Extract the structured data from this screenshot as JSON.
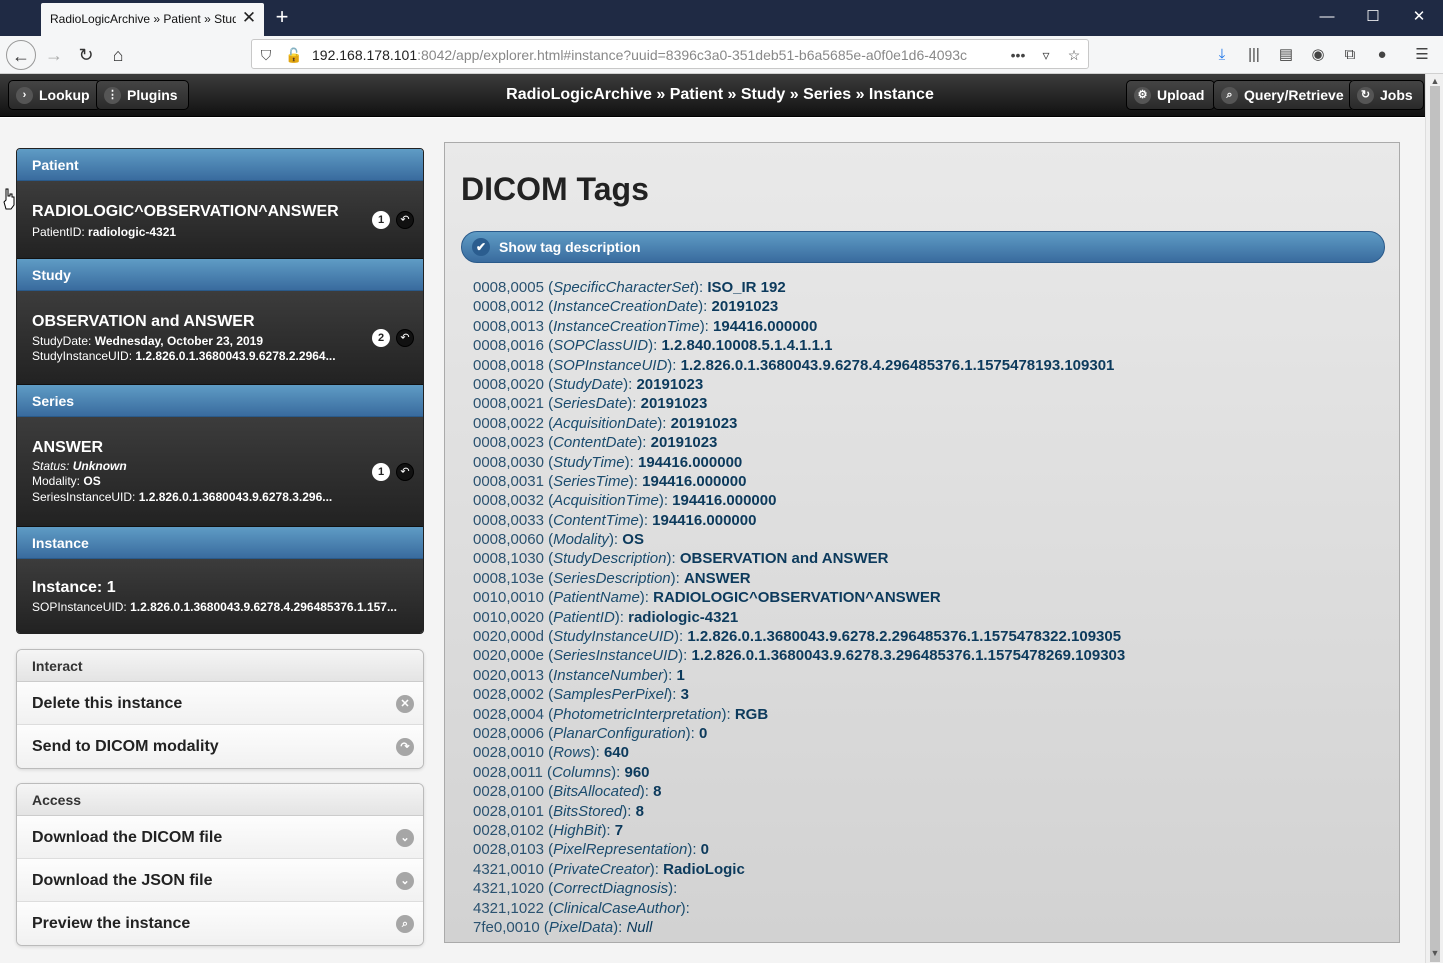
{
  "browser": {
    "tab_title": "RadioLogicArchive » Patient » Stud",
    "url_host": "192.168.178.101",
    "url_rest": ":8042/app/explorer.html#instance?uuid=8396c3a0-351deb51-b6a5685e-a0f0e1d6-4093c"
  },
  "header": {
    "lookup_label": "Lookup",
    "plugins_label": "Plugins",
    "title": "RadioLogicArchive » Patient » Study » Series » Instance",
    "upload_label": "Upload",
    "query_label": "Query/Retrieve",
    "jobs_label": "Jobs"
  },
  "nav": {
    "patient": {
      "divider": "Patient",
      "name": "RADIOLOGIC^OBSERVATION^ANSWER",
      "id_label": "PatientID:",
      "id_value": "radiologic-4321",
      "count": "1"
    },
    "study": {
      "divider": "Study",
      "title": "OBSERVATION and ANSWER",
      "date_label": "StudyDate:",
      "date_value": "Wednesday, October 23, 2019",
      "uid_label": "StudyInstanceUID:",
      "uid_value": "1.2.826.0.1.3680043.9.6278.2.2964...",
      "count": "2"
    },
    "series": {
      "divider": "Series",
      "title": "ANSWER",
      "status_label": "Status:",
      "status_value": "Unknown",
      "modality_label": "Modality:",
      "modality_value": "OS",
      "uid_label": "SeriesInstanceUID:",
      "uid_value": "1.2.826.0.1.3680043.9.6278.3.296...",
      "count": "1"
    },
    "instance": {
      "divider": "Instance",
      "title": "Instance: 1",
      "uid_label": "SOPInstanceUID:",
      "uid_value": "1.2.826.0.1.3680043.9.6278.4.296485376.1.157..."
    }
  },
  "interact": {
    "heading": "Interact",
    "delete_label": "Delete this instance",
    "send_label": "Send to DICOM modality"
  },
  "access": {
    "heading": "Access",
    "download_dicom": "Download the DICOM file",
    "download_json": "Download the JSON file",
    "preview": "Preview the instance"
  },
  "main": {
    "heading": "DICOM Tags",
    "toggle_label": "Show tag description",
    "tags": [
      {
        "id": "0008,0005",
        "name": "SpecificCharacterSet",
        "value": "ISO_IR 192"
      },
      {
        "id": "0008,0012",
        "name": "InstanceCreationDate",
        "value": "20191023"
      },
      {
        "id": "0008,0013",
        "name": "InstanceCreationTime",
        "value": "194416.000000"
      },
      {
        "id": "0008,0016",
        "name": "SOPClassUID",
        "value": "1.2.840.10008.5.1.4.1.1.1"
      },
      {
        "id": "0008,0018",
        "name": "SOPInstanceUID",
        "value": "1.2.826.0.1.3680043.9.6278.4.296485376.1.1575478193.109301"
      },
      {
        "id": "0008,0020",
        "name": "StudyDate",
        "value": "20191023"
      },
      {
        "id": "0008,0021",
        "name": "SeriesDate",
        "value": "20191023"
      },
      {
        "id": "0008,0022",
        "name": "AcquisitionDate",
        "value": "20191023"
      },
      {
        "id": "0008,0023",
        "name": "ContentDate",
        "value": "20191023"
      },
      {
        "id": "0008,0030",
        "name": "StudyTime",
        "value": "194416.000000"
      },
      {
        "id": "0008,0031",
        "name": "SeriesTime",
        "value": "194416.000000"
      },
      {
        "id": "0008,0032",
        "name": "AcquisitionTime",
        "value": "194416.000000"
      },
      {
        "id": "0008,0033",
        "name": "ContentTime",
        "value": "194416.000000"
      },
      {
        "id": "0008,0060",
        "name": "Modality",
        "value": "OS"
      },
      {
        "id": "0008,1030",
        "name": "StudyDescription",
        "value": "OBSERVATION and ANSWER"
      },
      {
        "id": "0008,103e",
        "name": "SeriesDescription",
        "value": "ANSWER"
      },
      {
        "id": "0010,0010",
        "name": "PatientName",
        "value": "RADIOLOGIC^OBSERVATION^ANSWER"
      },
      {
        "id": "0010,0020",
        "name": "PatientID",
        "value": "radiologic-4321"
      },
      {
        "id": "0020,000d",
        "name": "StudyInstanceUID",
        "value": "1.2.826.0.1.3680043.9.6278.2.296485376.1.1575478322.109305"
      },
      {
        "id": "0020,000e",
        "name": "SeriesInstanceUID",
        "value": "1.2.826.0.1.3680043.9.6278.3.296485376.1.1575478269.109303"
      },
      {
        "id": "0020,0013",
        "name": "InstanceNumber",
        "value": "1"
      },
      {
        "id": "0028,0002",
        "name": "SamplesPerPixel",
        "value": "3"
      },
      {
        "id": "0028,0004",
        "name": "PhotometricInterpretation",
        "value": "RGB"
      },
      {
        "id": "0028,0006",
        "name": "PlanarConfiguration",
        "value": "0"
      },
      {
        "id": "0028,0010",
        "name": "Rows",
        "value": "640"
      },
      {
        "id": "0028,0011",
        "name": "Columns",
        "value": "960"
      },
      {
        "id": "0028,0100",
        "name": "BitsAllocated",
        "value": "8"
      },
      {
        "id": "0028,0101",
        "name": "BitsStored",
        "value": "8"
      },
      {
        "id": "0028,0102",
        "name": "HighBit",
        "value": "7"
      },
      {
        "id": "0028,0103",
        "name": "PixelRepresentation",
        "value": "0"
      },
      {
        "id": "4321,0010",
        "name": "PrivateCreator",
        "value": "RadioLogic"
      },
      {
        "id": "4321,1020",
        "name": "CorrectDiagnosis",
        "value": ""
      },
      {
        "id": "4321,1022",
        "name": "ClinicalCaseAuthor",
        "value": ""
      },
      {
        "id": "7fe0,0010",
        "name": "PixelData",
        "value": "Null",
        "italic_value": true
      }
    ]
  },
  "colors": {
    "header_bg": "#1f2a44",
    "divider_blue": "#4a84b4",
    "item_dark": "#2e2e2e"
  }
}
